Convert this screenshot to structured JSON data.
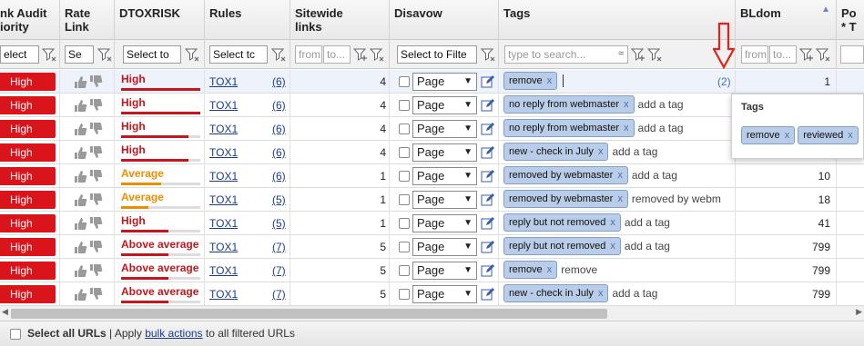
{
  "columns": {
    "link_audit": "nk Audit\niority",
    "rate_link": "Rate\nLink",
    "dtoxrisk": "DTOXRISK",
    "rules": "Rules",
    "sitewide": "Sitewide\nlinks",
    "disavow": "Disavow",
    "tags": "Tags",
    "bldom": "BLdom",
    "last": "Po\n* T"
  },
  "sort_indicator": "▲",
  "filters": {
    "audit_select": "elect",
    "rate_select": "Se",
    "dtox_select": "Select to",
    "rules_select": "Select tc",
    "sitewide_from": "from",
    "sitewide_to": "to...",
    "disavow_select": "Select to Filte",
    "tags_search_placeholder": "type to search...",
    "bldom_from": "from",
    "bldom_to": "to..."
  },
  "rows": [
    {
      "priority": "High",
      "risk": "High",
      "risk_color": "#c4161c",
      "risk_fraction": 1.0,
      "rule": "TOX1",
      "rule_count": "(6)",
      "sitewide": "4",
      "disavow": "Page",
      "tags": [
        "remove"
      ],
      "tag_text": "",
      "tag_count": "(2)",
      "bldom": "1"
    },
    {
      "priority": "High",
      "risk": "High",
      "risk_color": "#c4161c",
      "risk_fraction": 1.0,
      "rule": "TOX1",
      "rule_count": "(6)",
      "sitewide": "4",
      "disavow": "Page",
      "tags": [
        "no reply from webmaster"
      ],
      "tag_text": "add a tag",
      "tag_count": "",
      "bldom": ""
    },
    {
      "priority": "High",
      "risk": "High",
      "risk_color": "#c4161c",
      "risk_fraction": 0.85,
      "rule": "TOX1",
      "rule_count": "(6)",
      "sitewide": "4",
      "disavow": "Page",
      "tags": [
        "no reply from webmaster"
      ],
      "tag_text": "add a tag",
      "tag_count": "",
      "bldom": ""
    },
    {
      "priority": "High",
      "risk": "High",
      "risk_color": "#c4161c",
      "risk_fraction": 0.85,
      "rule": "TOX1",
      "rule_count": "(6)",
      "sitewide": "4",
      "disavow": "Page",
      "tags": [
        "new - check in July"
      ],
      "tag_text": "add a tag",
      "tag_count": "",
      "bldom": ""
    },
    {
      "priority": "High",
      "risk": "Average",
      "risk_color": "#f08c00",
      "risk_fraction": 0.5,
      "rule": "TOX1",
      "rule_count": "(6)",
      "sitewide": "1",
      "disavow": "Page",
      "tags": [
        "removed by webmaster"
      ],
      "tag_text": "add a tag",
      "tag_count": "",
      "bldom": "10"
    },
    {
      "priority": "High",
      "risk": "Average",
      "risk_color": "#f08c00",
      "risk_fraction": 0.35,
      "rule": "TOX1",
      "rule_count": "(5)",
      "sitewide": "1",
      "disavow": "Page",
      "tags": [
        "removed by webmaster"
      ],
      "tag_text": "removed by webm",
      "tag_count": "",
      "bldom": "18"
    },
    {
      "priority": "High",
      "risk": "High",
      "risk_color": "#c4161c",
      "risk_fraction": 0.6,
      "rule": "TOX1",
      "rule_count": "(5)",
      "sitewide": "1",
      "disavow": "Page",
      "tags": [
        "reply but not removed"
      ],
      "tag_text": "add a tag",
      "tag_count": "",
      "bldom": "41"
    },
    {
      "priority": "High",
      "risk": "Above average",
      "risk_color": "#c4161c",
      "risk_fraction": 0.6,
      "rule": "TOX1",
      "rule_count": "(7)",
      "sitewide": "5",
      "disavow": "Page",
      "tags": [
        "reply but not removed"
      ],
      "tag_text": "add a tag",
      "tag_count": "",
      "bldom": "799"
    },
    {
      "priority": "High",
      "risk": "Above average",
      "risk_color": "#c4161c",
      "risk_fraction": 0.6,
      "rule": "TOX1",
      "rule_count": "(7)",
      "sitewide": "5",
      "disavow": "Page",
      "tags": [
        "remove"
      ],
      "tag_text": "remove",
      "tag_count": "",
      "bldom": "799"
    },
    {
      "priority": "High",
      "risk": "Above average",
      "risk_color": "#c4161c",
      "risk_fraction": 0.6,
      "rule": "TOX1",
      "rule_count": "(7)",
      "sitewide": "5",
      "disavow": "Page",
      "tags": [
        "new - check in July"
      ],
      "tag_text": "add a tag",
      "tag_count": "",
      "bldom": "799"
    }
  ],
  "popup": {
    "title": "Tags",
    "tags": [
      "remove",
      "reviewed"
    ]
  },
  "footer": {
    "select_all": "Select all URLs",
    "sep": " | Apply ",
    "bulk_actions": "bulk actions",
    "suffix": " to all filtered URLs"
  },
  "tag_remove_glyph": "x",
  "colors": {
    "priority_badge": "#d9141b",
    "tag_bg": "#b9cde8",
    "link": "#1a3c8c",
    "arrow": "#e32219"
  }
}
